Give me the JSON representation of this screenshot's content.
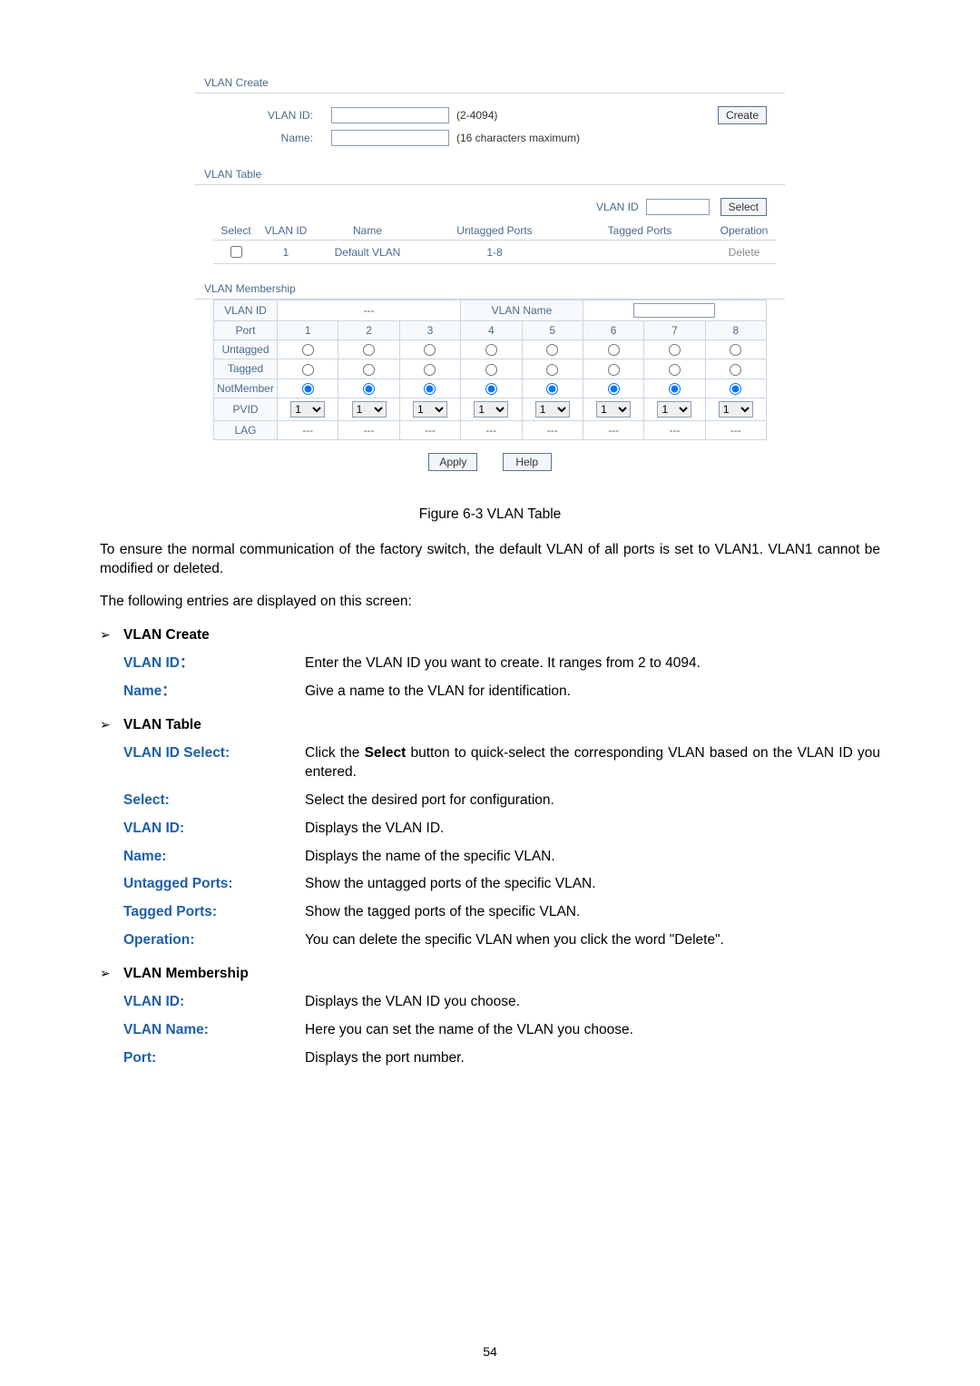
{
  "ui": {
    "create": {
      "section_title": "VLAN Create",
      "vlanid_label": "VLAN ID:",
      "vlanid_hint": "(2-4094)",
      "name_label": "Name:",
      "name_hint": "(16 characters maximum)",
      "create_btn": "Create"
    },
    "table": {
      "section_title": "VLAN Table",
      "search_label": "VLAN ID",
      "select_btn": "Select",
      "cols": {
        "select": "Select",
        "vlanid": "VLAN ID",
        "name": "Name",
        "untagged": "Untagged Ports",
        "tagged": "Tagged Ports",
        "op": "Operation"
      },
      "row1": {
        "vlanid": "1",
        "name": "Default VLAN",
        "untagged": "1-8",
        "tagged": "",
        "op": "Delete"
      }
    },
    "membership": {
      "section_title": "VLAN Membership",
      "vlanid_label": "VLAN ID",
      "vlanid_value": "---",
      "vlanname_label": "VLAN Name",
      "vlanname_value": "",
      "port_label": "Port",
      "ports": [
        "1",
        "2",
        "3",
        "4",
        "5",
        "6",
        "7",
        "8"
      ],
      "rows": {
        "untagged": "Untagged",
        "tagged": "Tagged",
        "notmember": "NotMember",
        "pvid": "PVID",
        "lag": "LAG"
      },
      "pvid_value": "1",
      "lag_dash": "---"
    },
    "buttons": {
      "apply": "Apply",
      "help": "Help"
    }
  },
  "figure_caption": "Figure 6-3 VLAN Table",
  "para1": "To ensure the normal communication of the factory switch, the default VLAN of all ports is set to VLAN1. VLAN1 cannot be modified or deleted.",
  "para2": "The following entries are displayed on this screen:",
  "sections": {
    "create": "VLAN Create",
    "table": "VLAN Table",
    "membership": "VLAN Membership"
  },
  "defs_create": {
    "vlanid": {
      "term": "VLAN ID：",
      "desc": "Enter the VLAN ID you want to create. It ranges from 2 to 4094."
    },
    "name": {
      "term": "Name：",
      "desc": "Give a name to the VLAN for identification."
    }
  },
  "defs_table": {
    "vidselect": {
      "term": "VLAN ID Select:",
      "desc_pre": "Click the ",
      "desc_bold": "Select",
      "desc_post": " button to quick-select the corresponding VLAN based on the VLAN ID you entered."
    },
    "select": {
      "term": "Select:",
      "desc": "Select the desired port for configuration."
    },
    "vlanid": {
      "term": "VLAN ID:",
      "desc": "Displays the VLAN ID."
    },
    "name": {
      "term": "Name:",
      "desc": "Displays the name of the specific VLAN."
    },
    "untagged": {
      "term": "Untagged Ports:",
      "desc": "Show the untagged ports of the specific VLAN."
    },
    "tagged": {
      "term": "Tagged Ports:",
      "desc": "Show the tagged ports of the specific VLAN."
    },
    "operation": {
      "term": "Operation:",
      "desc": "You can delete the specific VLAN when you click the word \"Delete\"."
    }
  },
  "defs_membership": {
    "vlanid": {
      "term": "VLAN ID:",
      "desc": "Displays the VLAN ID you choose."
    },
    "vlanname": {
      "term": "VLAN Name:",
      "desc": "Here you can set the name of the VLAN you choose."
    },
    "port": {
      "term": "Port:",
      "desc": "Displays the port number."
    }
  },
  "page_number": "54"
}
